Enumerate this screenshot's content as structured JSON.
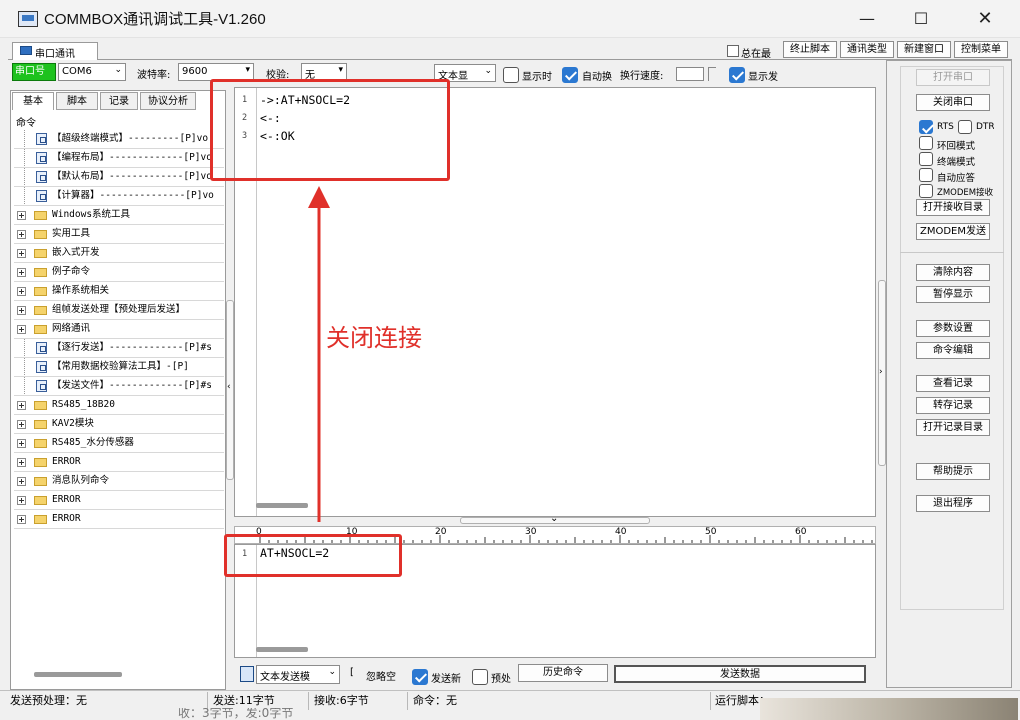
{
  "window": {
    "title": "COMMBOX通讯调试工具-V1.260"
  },
  "tabs": {
    "active": "串口通讯"
  },
  "top_right": {
    "always_on_top": "总在最",
    "stop_script": "终止脚本",
    "comm_type": "通讯类型",
    "new_window": "新建窗口",
    "control_menu": "控制菜单"
  },
  "port_bar": {
    "port_label": "串口号",
    "port_value": "COM6",
    "baud_label": "波特率:",
    "baud_value": "9600",
    "parity_label": "校验:",
    "parity_value": "无"
  },
  "recv_bar": {
    "text_display": "文本显",
    "show_time": "显示时",
    "auto_wrap": "自动换",
    "line_speed": "换行速度:",
    "show_send": "显示发"
  },
  "left_tabs": [
    "基本",
    "脚本",
    "记录",
    "协议分析"
  ],
  "tree": {
    "root": "命令",
    "items": [
      {
        "kind": "doc",
        "text": "【超级终端模式】---------[P]vo"
      },
      {
        "kind": "doc",
        "text": "【编程布局】-------------[P]vo"
      },
      {
        "kind": "doc",
        "text": "【默认布局】-------------[P]vo"
      },
      {
        "kind": "doc",
        "text": "【计算器】---------------[P]vo"
      },
      {
        "kind": "folder",
        "text": "Windows系统工具"
      },
      {
        "kind": "folder",
        "text": "实用工具"
      },
      {
        "kind": "folder",
        "text": "嵌入式开发"
      },
      {
        "kind": "folder",
        "text": "例子命令"
      },
      {
        "kind": "folder",
        "text": "操作系统相关"
      },
      {
        "kind": "folder",
        "text": "组帧发送处理【预处理后发送】"
      },
      {
        "kind": "folder",
        "text": "网络通讯"
      },
      {
        "kind": "doc",
        "text": "【逐行发送】-------------[P]#s"
      },
      {
        "kind": "doc",
        "text": "【常用数据校验算法工具】-[P]"
      },
      {
        "kind": "doc",
        "text": "【发送文件】-------------[P]#s"
      },
      {
        "kind": "folder",
        "text": "RS485_18B20"
      },
      {
        "kind": "folder",
        "text": "KAV2模块"
      },
      {
        "kind": "folder",
        "text": "RS485_水分传感器"
      },
      {
        "kind": "folder",
        "text": "ERROR"
      },
      {
        "kind": "folder",
        "text": "消息队列命令"
      },
      {
        "kind": "folder",
        "text": "ERROR"
      },
      {
        "kind": "folder",
        "text": "ERROR"
      }
    ]
  },
  "receive": {
    "lines": [
      "->:AT+NSOCL=2",
      "<-:",
      "<-:OK"
    ],
    "line_numbers": [
      "1",
      "2",
      "3"
    ]
  },
  "ruler": {
    "ticks": [
      "0",
      "10",
      "20",
      "30",
      "40",
      "50",
      "60"
    ]
  },
  "send": {
    "lines": [
      "AT+NSOCL=2"
    ],
    "line_numbers": [
      "1"
    ]
  },
  "annotation": {
    "text": "关闭连接",
    "color": "#e0302a"
  },
  "right_buttons": {
    "open_port": "打开串口",
    "close_port": "关闭串口",
    "rts": "RTS",
    "dtr": "DTR",
    "loopback": "环回模式",
    "terminal": "终端模式",
    "auto_reply": "自动应答",
    "zmodem_recv": "ZMODEM接收",
    "open_recv_dir": "打开接收目录",
    "zmodem_send": "ZMODEM发送",
    "clear": "清除内容",
    "pause": "暂停显示",
    "params": "参数设置",
    "cmd_edit": "命令编辑",
    "view_log": "查看记录",
    "save_log": "转存记录",
    "open_log_dir": "打开记录目录",
    "help": "帮助提示",
    "exit": "退出程序"
  },
  "send_bar": {
    "mode": "文本发送模",
    "ignore_space": "忽略空",
    "send_newline": "发送新",
    "preprocess": "预处",
    "history": "历史命令",
    "send_data": "发送数据"
  },
  "status": {
    "pre": "发送预处理：无",
    "sent": "发送:11字节",
    "recv": "接收:6字节",
    "cmd": "命令：无",
    "script": "运行脚本：",
    "overflow": "收：3字节，发:0字节"
  }
}
